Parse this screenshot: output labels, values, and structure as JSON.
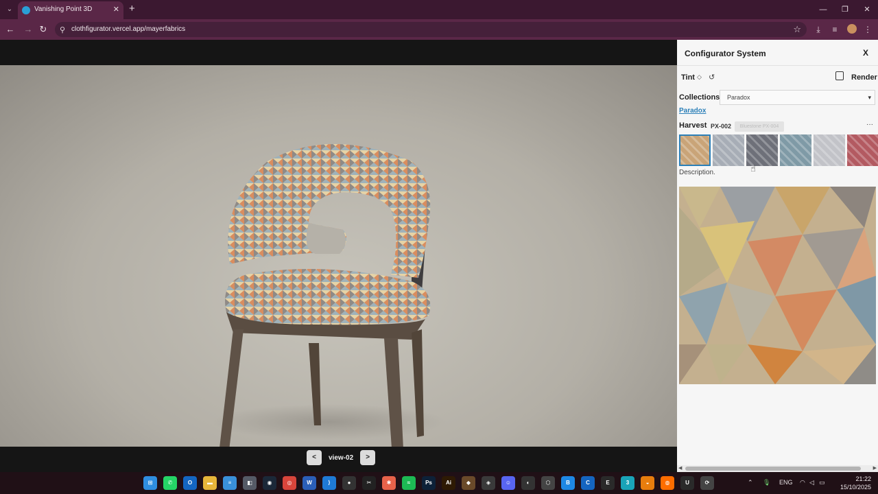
{
  "browser": {
    "tab_title": "Vanishing Point 3D",
    "tab_close": "✕",
    "new_tab": "+",
    "url": "clothfigurator.vercel.app/mayerfabrics",
    "window_controls": {
      "minimize": "—",
      "maximize": "❐",
      "close": "✕"
    }
  },
  "viewer": {
    "view_label": "view-02",
    "prev_label": "<",
    "next_label": ">"
  },
  "panel": {
    "title": "Configurator System",
    "close_label": "X",
    "tint_label": "Tint",
    "render_label": "Render",
    "collections_label": "Collections",
    "collection_selected": "Paradox",
    "collection_link": "Paradox",
    "fabric_name": "Harvest",
    "fabric_code": "PX-002",
    "fabric_tooltip": "Bluestone PX-004",
    "more_label": "···",
    "description": "Description.",
    "swatch_colors": [
      "#c9a478",
      "#a7adb6",
      "#6e7079",
      "#7f9aa6",
      "#c2c3c8",
      "#b35a61"
    ],
    "selected_swatch": 0
  },
  "taskbar": {
    "language": "ENG",
    "time": "21:22",
    "date": "15/10/2025",
    "apps": [
      {
        "name": "start",
        "color": "#2f8ee0",
        "glyph": "⊞"
      },
      {
        "name": "whatsapp",
        "color": "#25d366",
        "glyph": "✆"
      },
      {
        "name": "outlook",
        "color": "#1466c2",
        "glyph": "O"
      },
      {
        "name": "file-explorer",
        "color": "#e8b53a",
        "glyph": "▬"
      },
      {
        "name": "notepad",
        "color": "#3a8fd9",
        "glyph": "≡"
      },
      {
        "name": "store",
        "color": "#555a66",
        "glyph": "◧"
      },
      {
        "name": "steam",
        "color": "#1b2838",
        "glyph": "◉"
      },
      {
        "name": "chrome",
        "color": "#d9453b",
        "glyph": "◎"
      },
      {
        "name": "word",
        "color": "#2b5fb8",
        "glyph": "W"
      },
      {
        "name": "vscode",
        "color": "#1f7ad6",
        "glyph": "⟩"
      },
      {
        "name": "obs",
        "color": "#333333",
        "glyph": "●"
      },
      {
        "name": "capcut",
        "color": "#222222",
        "glyph": "✂"
      },
      {
        "name": "app-orange",
        "color": "#e8624a",
        "glyph": "✱"
      },
      {
        "name": "spotify",
        "color": "#1db954",
        "glyph": "≈"
      },
      {
        "name": "photoshop",
        "color": "#0d2138",
        "glyph": "Ps"
      },
      {
        "name": "illustrator",
        "color": "#2e1a04",
        "glyph": "Ai"
      },
      {
        "name": "app-brown",
        "color": "#6a4a2a",
        "glyph": "◆"
      },
      {
        "name": "davinci",
        "color": "#3a3a3a",
        "glyph": "◈"
      },
      {
        "name": "discord",
        "color": "#5865f2",
        "glyph": "☺"
      },
      {
        "name": "github",
        "color": "#333333",
        "glyph": "◐"
      },
      {
        "name": "unity",
        "color": "#444444",
        "glyph": "⬡"
      },
      {
        "name": "app-blue",
        "color": "#1e88e5",
        "glyph": "B"
      },
      {
        "name": "app-blue2",
        "color": "#1565c0",
        "glyph": "C"
      },
      {
        "name": "epic",
        "color": "#2a2a2a",
        "glyph": "E"
      },
      {
        "name": "3dsmax",
        "color": "#1aa3b8",
        "glyph": "3"
      },
      {
        "name": "blender",
        "color": "#e87d0d",
        "glyph": "◒"
      },
      {
        "name": "houdini",
        "color": "#ff6d00",
        "glyph": "◍"
      },
      {
        "name": "unreal",
        "color": "#2a2a2a",
        "glyph": "U"
      },
      {
        "name": "app-gray",
        "color": "#444444",
        "glyph": "⟳"
      }
    ]
  }
}
